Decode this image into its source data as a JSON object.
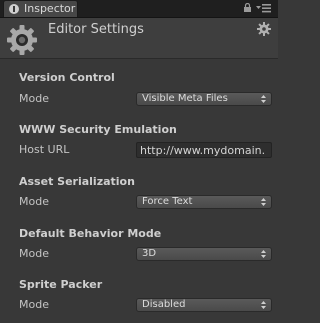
{
  "tab": {
    "label": "Inspector",
    "icon": "info-icon"
  },
  "header": {
    "title": "Editor Settings",
    "icon": "gear-icon"
  },
  "sections": [
    {
      "title": "Version Control",
      "field_label": "Mode",
      "value": "Visible Meta Files"
    },
    {
      "title": "WWW Security Emulation",
      "field_label": "Host URL",
      "value": "http://www.mydomain."
    },
    {
      "title": "Asset Serialization",
      "field_label": "Mode",
      "value": "Force Text"
    },
    {
      "title": "Default Behavior Mode",
      "field_label": "Mode",
      "value": "3D"
    },
    {
      "title": "Sprite Packer",
      "field_label": "Mode",
      "value": "Disabled"
    }
  ],
  "colors": {
    "background": "#383838",
    "tab_bar": "#1f1f1f",
    "text": "#c2c2c2"
  }
}
